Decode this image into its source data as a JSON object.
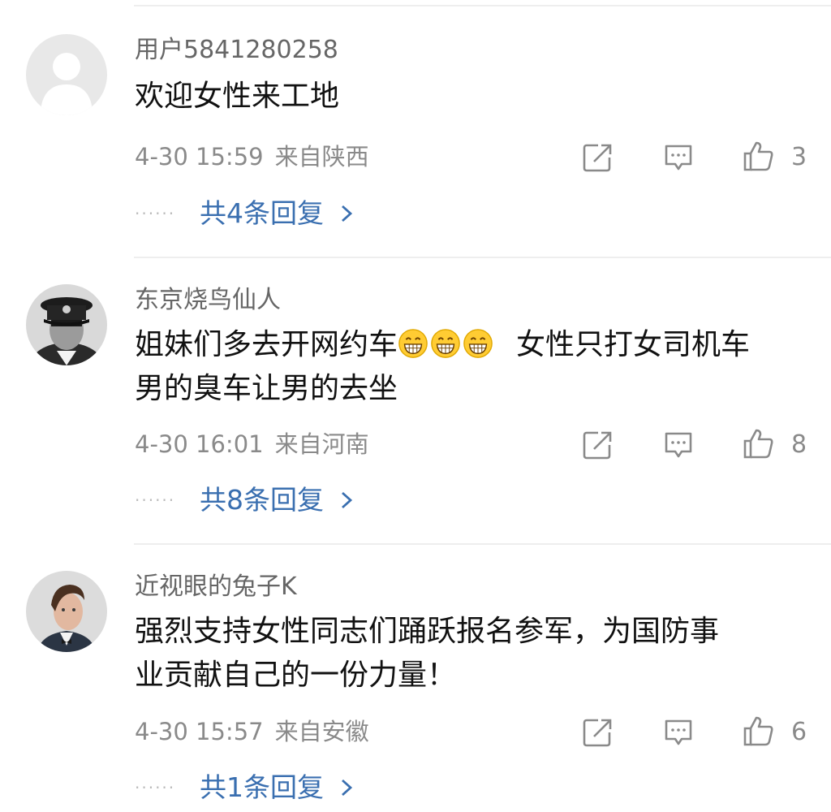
{
  "comments": [
    {
      "username": "用户5841280258",
      "text": "欢迎女性来工地",
      "time": "4-30 15:59",
      "location": "来自陕西",
      "likes": "3",
      "replies": "共4条回复",
      "avatar_icon": "default-user-avatar"
    },
    {
      "username": "东京烧鸟仙人",
      "text_part1": "姐妹们多去开网约车",
      "emoji_name": "grin-emoji",
      "emoji_count": 3,
      "text_part2": "女性只打女司机车",
      "text_line2": "男的臭车让男的去坐",
      "time": "4-30 16:01",
      "location": "来自河南",
      "likes": "8",
      "replies": "共8条回复",
      "avatar_icon": "officer-photo-avatar"
    },
    {
      "username": "近视眼的兔子K",
      "text_line1": "强烈支持女性同志们踊跃报名参军，为国防事",
      "text_line2": "业贡献自己的一份力量！",
      "time": "4-30 15:57",
      "location": "来自安徽",
      "likes": "6",
      "replies": "共1条回复",
      "avatar_icon": "portrait-photo-avatar"
    }
  ],
  "icons": {
    "share": "share-icon",
    "comment": "comment-icon",
    "like": "thumbs-up-icon",
    "chevron": "chevron-right-icon"
  },
  "colors": {
    "link": "#3a6fb0",
    "meta": "#8a8a8a",
    "username": "#666666",
    "text": "#111111"
  }
}
